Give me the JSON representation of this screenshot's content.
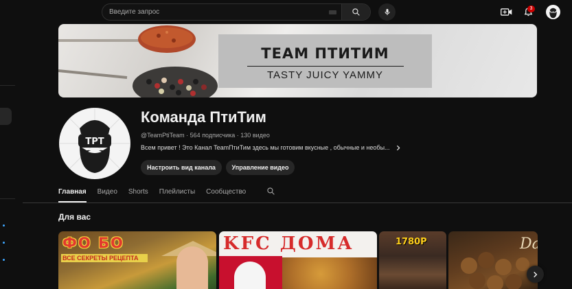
{
  "search": {
    "placeholder": "Введите запрос"
  },
  "notifications": {
    "count": "3"
  },
  "banner": {
    "title": "TEAM ПТИТИМ",
    "subtitle": "TASTY JUICY YAMMY"
  },
  "channel": {
    "name": "Команда ПтиТим",
    "handle": "@TeamPtiTeam",
    "subscribers": "564 подписчика",
    "videos": "130 видео",
    "description": "Всем привет ! Это Канал TeamПтиТим здесь мы готовим вкусные , обычные и необы...",
    "avatar_text": "TPT"
  },
  "actions": {
    "customize": "Настроить вид канала",
    "manage": "Управление видео"
  },
  "tabs": [
    {
      "label": "Главная",
      "active": true
    },
    {
      "label": "Видео",
      "active": false
    },
    {
      "label": "Shorts",
      "active": false
    },
    {
      "label": "Плейлисты",
      "active": false
    },
    {
      "label": "Сообщество",
      "active": false
    }
  ],
  "section": {
    "title": "Для вас"
  },
  "thumbnails": [
    {
      "caption": "ФО БО",
      "subcaption": "ВСЕ СЕКРЕТЫ РЕЦЕПТА"
    },
    {
      "caption": "KFC ДОМА"
    },
    {
      "caption": "1780Р"
    },
    {
      "caption": "Da"
    }
  ],
  "colors": {
    "background": "#0f0f0f",
    "accent": "#3ea6ff",
    "badge": "#cc0000",
    "pill": "#272727"
  }
}
